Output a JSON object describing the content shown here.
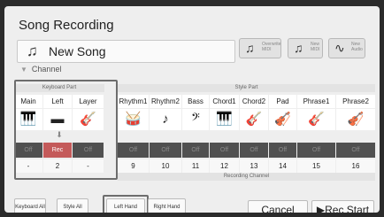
{
  "header": {
    "title": "Song Recording",
    "song_name": "New Song",
    "buttons": [
      {
        "label": "Overwrite MIDI"
      },
      {
        "label": "New MIDI"
      },
      {
        "label": "New Audio"
      }
    ]
  },
  "channel_label": "Channel",
  "groups": {
    "keyboard": "Keyboard Part",
    "style": "Style Part"
  },
  "parts": [
    {
      "name": "Main",
      "icon": "piano-icon",
      "status": "Off",
      "channel": "-"
    },
    {
      "name": "Left",
      "icon": "keyboard-icon",
      "status": "Rec",
      "channel": "2"
    },
    {
      "name": "Layer",
      "icon": "guitar-icon",
      "status": "Off",
      "channel": "-"
    },
    {
      "name": "Rhythm1",
      "icon": "drum-kit-icon",
      "status": "Off",
      "channel": "9"
    },
    {
      "name": "Rhythm2",
      "icon": "percussion-icon",
      "status": "Off",
      "channel": "10"
    },
    {
      "name": "Bass",
      "icon": "bass-guitar-icon",
      "status": "Off",
      "channel": "11"
    },
    {
      "name": "Chord1",
      "icon": "piano-icon",
      "status": "Off",
      "channel": "12"
    },
    {
      "name": "Chord2",
      "icon": "guitar-icon",
      "status": "Off",
      "channel": "13"
    },
    {
      "name": "Pad",
      "icon": "strings-icon",
      "status": "Off",
      "channel": "14"
    },
    {
      "name": "Phrase1",
      "icon": "guitar-icon",
      "status": "Off",
      "channel": "15"
    },
    {
      "name": "Phrase2",
      "icon": "strings-icon",
      "status": "Off",
      "channel": "16"
    }
  ],
  "recording_channel_label": "Recording Channel",
  "bottom": {
    "keyboard_all": "Keyboard All",
    "style_all": "Style All",
    "left_hand": "Left Hand",
    "right_hand": "Right Hand",
    "cancel": "Cancel",
    "rec_start": "Rec Start"
  },
  "colors": {
    "rec_active": "#c45a5a",
    "off_cell": "#505050"
  }
}
